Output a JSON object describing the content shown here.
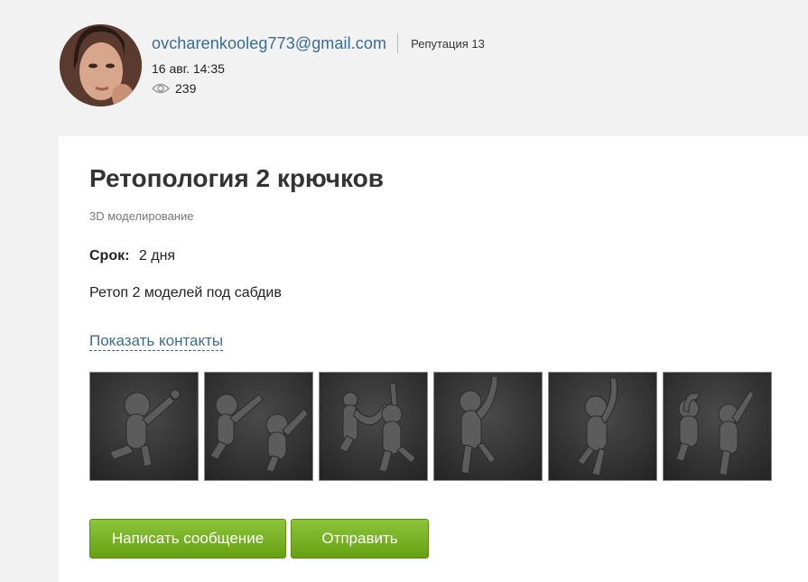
{
  "author": {
    "email": "ovcharenkooleg773@gmail.com",
    "reputation": "Репутация 13",
    "date": "16 авг. 14:35",
    "views": "239"
  },
  "task": {
    "title": "Ретопология 2 крючков",
    "category": "3D моделирование",
    "deadline_label": "Срок:",
    "deadline_value": "2 дня",
    "description": "Ретоп 2 моделей под сабдив",
    "contacts_link": "Показать контакты"
  },
  "gallery": {
    "count": 6
  },
  "actions": {
    "write_message": "Написать сообщение",
    "send": "Отправить"
  },
  "colors": {
    "link": "#3b6c8f",
    "button_green": "#7ab32a",
    "page_bg": "#f2f2f2"
  },
  "icons": [
    "eye-icon"
  ]
}
